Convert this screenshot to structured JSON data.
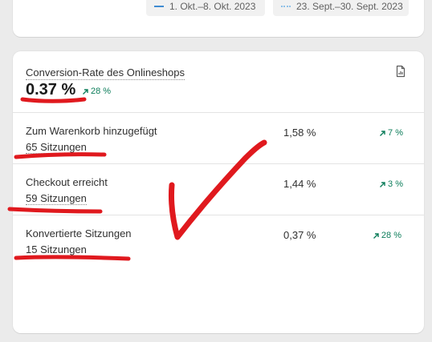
{
  "legend": {
    "current_period": "1. Okt.–8. Okt. 2023",
    "previous_period": "23. Sept.–30. Sept. 2023",
    "current_color": "#3f8bd1",
    "previous_color": "#8fc0e8"
  },
  "metric": {
    "title": "Conversion-Rate des Onlineshops",
    "value": "0.37 %",
    "change": "28 %",
    "change_color": "#0c7d5a",
    "icon": "report-icon"
  },
  "rows": [
    {
      "label": "Zum Warenkorb hinzugefügt",
      "sessions": "65 Sitzungen",
      "rate": "1,58 %",
      "change": "7 %"
    },
    {
      "label": "Checkout erreicht",
      "sessions": "59 Sitzungen",
      "rate": "1,44 %",
      "change": "3 %"
    },
    {
      "label": "Konvertierte Sitzungen",
      "sessions": "15 Sitzungen",
      "rate": "0,37 %",
      "change": "28 %"
    }
  ],
  "annotation_color": "#e0191e"
}
